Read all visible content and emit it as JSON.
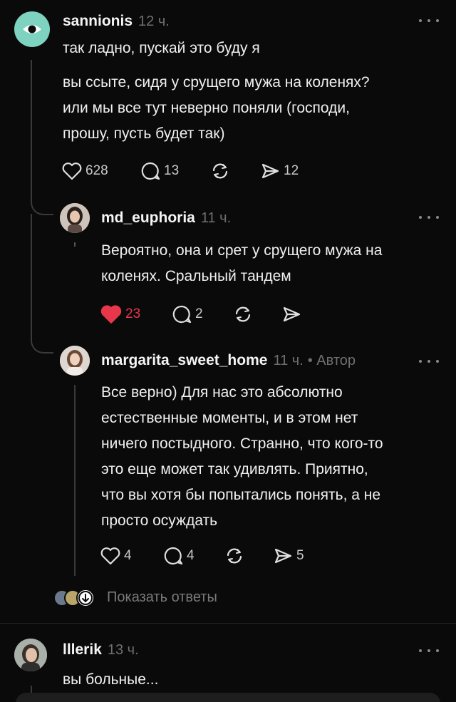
{
  "comments": [
    {
      "username": "sannionis",
      "time": "12 ч.",
      "text": "так ладно, пускай это буду я",
      "text2": "вы ссыте, сидя у срущего мужа на коленях?\nили мы все тут неверно поняли (господи,\nпрошу, пусть будет так)",
      "likes": "628",
      "replies": "13",
      "shares": "12",
      "avatar_color": "#7dd3c0"
    },
    {
      "username": "md_euphoria",
      "time": "11 ч.",
      "text": "Вероятно, она и срет у срущего мужа на\nколенях. Сральный тандем",
      "likes": "23",
      "replies": "2",
      "liked": true
    },
    {
      "username": "margarita_sweet_home",
      "time": "11 ч.",
      "author_tag": "• Автор",
      "text": "Все верно) Для нас это абсолютно\nестественные моменты, и в этом нет\nничего постыдного. Странно, что кого-то\nэто еще может так удивлять. Приятно,\nчто вы хотя бы попытались понять, а не\nпросто осуждать",
      "likes": "4",
      "replies": "4",
      "shares": "5"
    },
    {
      "username": "lllerik",
      "time": "13 ч.",
      "text": "вы больные..."
    }
  ],
  "show_replies_label": "Показать ответы",
  "colors": {
    "like_red": "#e8374a",
    "background": "#0a0a0a",
    "teal_avatar": "#7dd3c0"
  }
}
